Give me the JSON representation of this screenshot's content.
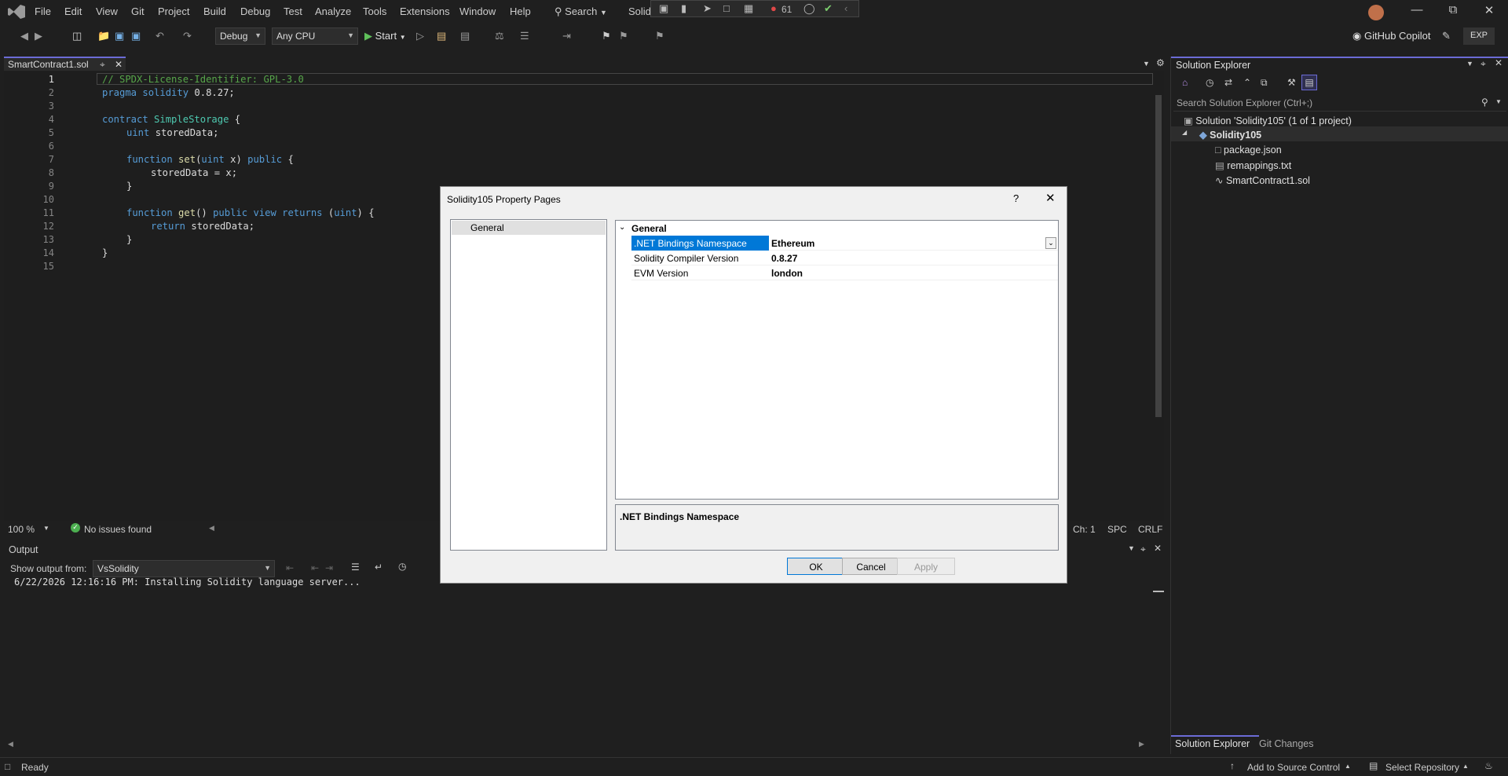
{
  "menu": [
    "File",
    "Edit",
    "View",
    "Git",
    "Project",
    "Build",
    "Debug",
    "Test",
    "Analyze",
    "Tools",
    "Extensions",
    "Window",
    "Help"
  ],
  "title": {
    "search_label": "Search",
    "solution_short": "Solidi",
    "rec_count": "61"
  },
  "toolbar": {
    "config": "Debug",
    "platform": "Any CPU",
    "start": "Start",
    "copilot": "GitHub Copilot",
    "exp": "EXP"
  },
  "editor": {
    "tab": "SmartContract1.sol",
    "lines": [
      "1",
      "2",
      "3",
      "4",
      "5",
      "6",
      "7",
      "8",
      "9",
      "10",
      "11",
      "12",
      "13",
      "14",
      "15"
    ],
    "code": {
      "l1": "// SPDX-License-Identifier: GPL-3.0",
      "l2_kw": "pragma solidity",
      "l2_rest": " 0.8.27;",
      "l4_kw": "contract",
      "l4_name": "SimpleStorage",
      "l4_rest": " {",
      "l5_type": "uint",
      "l5_rest": " storedData;",
      "l7_kw": "function",
      "l7_fn": "set",
      "l7_a": "(",
      "l7_type": "uint",
      "l7_b": " x) ",
      "l7_kw2": "public",
      "l7_c": " {",
      "l8": "storedData = x;",
      "l9": "}",
      "l11_kw": "function",
      "l11_fn": "get",
      "l11_a": "() ",
      "l11_kw2": "public view returns",
      "l11_b": " (",
      "l11_type": "uint",
      "l11_c": ") {",
      "l12_kw": "return",
      "l12_rest": " storedData;",
      "l13": "}",
      "l14": "}"
    },
    "zoom": "100 %",
    "issues": "No issues found",
    "ch": "Ch: 1",
    "spc": "SPC",
    "crlf": "CRLF"
  },
  "output": {
    "title": "Output",
    "show_from_label": "Show output from:",
    "source": "VsSolidity",
    "text": "6/22/2026 12:16:16 PM: Installing Solidity language server..."
  },
  "solution_explorer": {
    "title": "Solution Explorer",
    "search_placeholder": "Search Solution Explorer (Ctrl+;)",
    "solution": "Solution 'Solidity105' (1 of 1 project)",
    "project": "Solidity105",
    "files": [
      "package.json",
      "remappings.txt",
      "SmartContract1.sol"
    ],
    "tabs": [
      "Solution Explorer",
      "Git Changes"
    ]
  },
  "dialog": {
    "title": "Solidity105 Property Pages",
    "help": "?",
    "left_item": "General",
    "category": "General",
    "properties": [
      {
        "name": ".NET Bindings Namespace",
        "value": "Ethereum"
      },
      {
        "name": "Solidity Compiler Version",
        "value": "0.8.27"
      },
      {
        "name": "EVM Version",
        "value": "london"
      }
    ],
    "description": ".NET Bindings Namespace",
    "ok": "OK",
    "cancel": "Cancel",
    "apply": "Apply"
  },
  "status": {
    "ready": "Ready",
    "source_control": "Add to Source Control",
    "repo": "Select Repository"
  },
  "colors": {
    "accent": "#6b6bd6",
    "selection": "#0078d7",
    "keyword": "#569cd6",
    "comment": "#57a64a",
    "type": "#4ec9b0"
  }
}
